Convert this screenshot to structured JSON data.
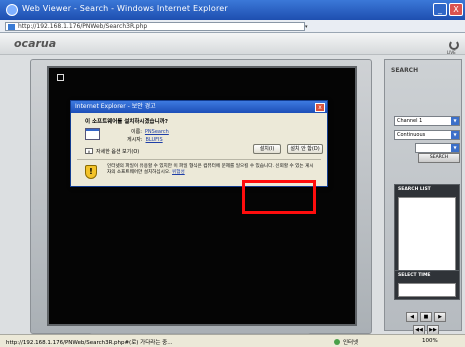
{
  "window": {
    "title": "Web Viewer - Search - Windows Internet Explorer",
    "minimize": "_",
    "close": "X"
  },
  "address_bar": {
    "url": "http://192.168.1.176/PNWeb/Search3R.php",
    "dropdown": "▾"
  },
  "app": {
    "logo": "ocarua",
    "refresh_label": "LIVE"
  },
  "dialog": {
    "title": "Internet Explorer - 보안 경고",
    "close": "x",
    "question": "이 소프트웨어를 설치하시겠습니까?",
    "name_label": "이름:",
    "name_value": "PNSearch",
    "publisher_label": "게시자:",
    "publisher_value": "BLUFIS",
    "more_options_chevron": "∨",
    "more_options": "자세한 옵션 보기(O)",
    "install_button": "설치(I)",
    "no_install_button": "설치 안 함(D)",
    "shield_mark": "!",
    "warning_text": "인터넷의 파일이 유용할 수 있지만 이 파일 형식은 컴퓨터에 문제를 일으킬 수 있습니다. 신뢰할 수 있는 게시자의 소프트웨어만 설치하십시오.",
    "warning_link": "위험성"
  },
  "panel": {
    "header": "SEARCH",
    "channel": "Channel 1",
    "mode": "Continuous",
    "search_button": "SEARCH",
    "search_list": "SEARCH LIST",
    "select_time": "SELECT TIME",
    "controls": [
      "◀",
      "■",
      "▶",
      "◀◀",
      "▶▶"
    ]
  },
  "statusbar": {
    "url": "http://192.168.1.176/PNWeb/Search3R.php#(로) 가다라는 중...",
    "zone": "인터넷",
    "zoom": "100%"
  }
}
